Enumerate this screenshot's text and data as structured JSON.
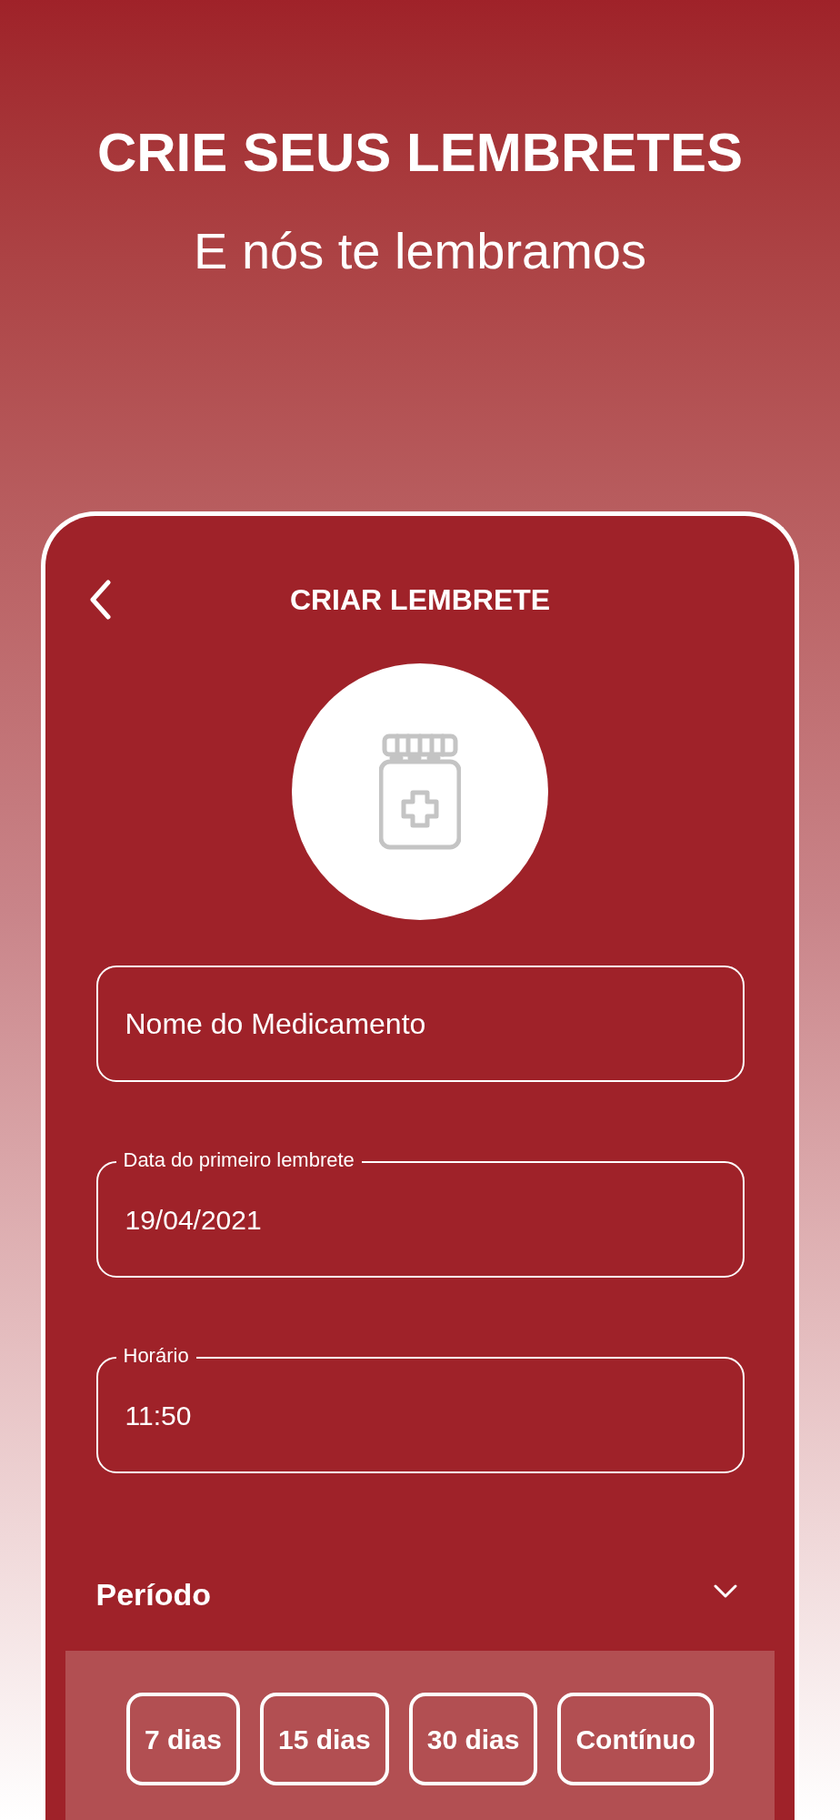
{
  "headline": "CRIE SEUS LEMBRETES",
  "subtitle": "E nós te lembramos",
  "screen": {
    "title": "CRIAR LEMBRETE",
    "fields": [
      {
        "placeholder": "Nome do Medicamento"
      },
      {
        "label": "Data do primeiro lembrete",
        "value": "19/04/2021"
      },
      {
        "label": "Horário",
        "value": "11:50"
      }
    ],
    "period": {
      "label": "Período",
      "options": [
        {
          "label": "7 dias",
          "selected": false
        },
        {
          "label": "15 dias",
          "selected": false
        },
        {
          "label": "30 dias",
          "selected": false
        },
        {
          "label": "Contínuo",
          "selected": false
        }
      ]
    }
  }
}
